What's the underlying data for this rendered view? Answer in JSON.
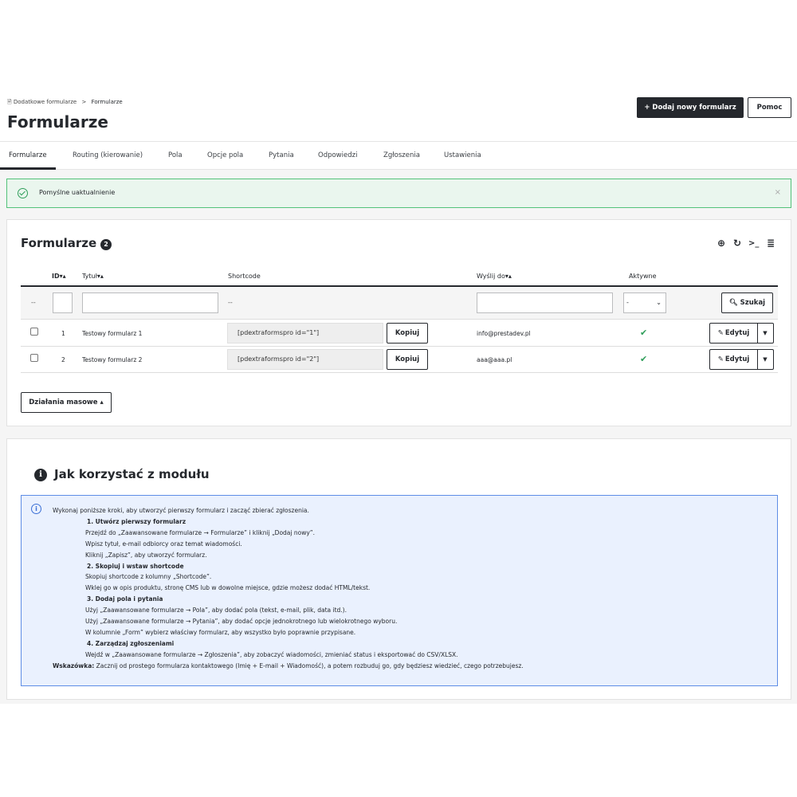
{
  "breadcrumb": {
    "parent": "Dodatkowe formularze",
    "separator": ">",
    "current": "Formularze"
  },
  "page_title": "Formularze",
  "toolbar": {
    "add_label": "+ Dodaj nowy formularz",
    "help_label": "Pomoc"
  },
  "tabs": [
    {
      "label": "Formularze",
      "active": true
    },
    {
      "label": "Routing (kierowanie)"
    },
    {
      "label": "Pola"
    },
    {
      "label": "Opcje pola"
    },
    {
      "label": "Pytania"
    },
    {
      "label": "Odpowiedzi"
    },
    {
      "label": "Zgłoszenia"
    },
    {
      "label": "Ustawienia"
    }
  ],
  "alert": {
    "message": "Pomyślne uaktualnienie",
    "close": "×"
  },
  "list": {
    "title": "Formularze",
    "count": "2",
    "columns": {
      "id": "ID",
      "title": "Tytuł",
      "shortcode": "Shortcode",
      "send_to": "Wyślij do",
      "active": "Aktywne",
      "sort": "▾▴"
    },
    "filters": {
      "dash": "--",
      "shortcode_dash": "--",
      "select_value": "-",
      "search_label": "Szukaj"
    },
    "rows": [
      {
        "id": "1",
        "title": "Testowy formularz 1",
        "shortcode": "[pdextraformspro id=\"1\"]",
        "copy": "Kopiuj",
        "send_to": "info@prestadev.pl",
        "edit": "Edytuj"
      },
      {
        "id": "2",
        "title": "Testowy formularz 2",
        "shortcode": "[pdextraformspro id=\"2\"]",
        "copy": "Kopiuj",
        "send_to": "aaa@aaa.pl",
        "edit": "Edytuj"
      }
    ],
    "bulk_label": "Działania masowe ▴"
  },
  "help": {
    "title": "Jak korzystać z modułu",
    "intro": "Wykonaj poniższe kroki, aby utworzyć pierwszy formularz i zacząć zbierać zgłoszenia.",
    "steps": [
      {
        "title": "1. Utwórz pierwszy formularz",
        "lines": [
          "Przejdź do „Zaawansowane formularze → Formularze” i kliknij „Dodaj nowy”.",
          "Wpisz tytuł, e-mail odbiorcy oraz temat wiadomości.",
          "Kliknij „Zapisz”, aby utworzyć formularz."
        ]
      },
      {
        "title": "2. Skopiuj i wstaw shortcode",
        "lines": [
          "Skopiuj shortcode z kolumny „Shortcode”.",
          "Wklej go w opis produktu, stronę CMS lub w dowolne miejsce, gdzie możesz dodać HTML/tekst."
        ]
      },
      {
        "title": "3. Dodaj pola i pytania",
        "lines": [
          "Użyj „Zaawansowane formularze → Pola”, aby dodać pola (tekst, e-mail, plik, data itd.).",
          "Użyj „Zaawansowane formularze → Pytania”, aby dodać opcje jednokrotnego lub wielokrotnego wyboru.",
          "W kolumnie „Form” wybierz właściwy formularz, aby wszystko było poprawnie przypisane."
        ]
      },
      {
        "title": "4. Zarządzaj zgłoszeniami",
        "lines": [
          "Wejdź w „Zaawansowane formularze → Zgłoszenia”, aby zobaczyć wiadomości, zmieniać status i eksportować do CSV/XLSX."
        ]
      }
    ],
    "tip_label": "Wskazówka:",
    "tip_text": "Zacznij od prostego formularza kontaktowego (Imię + E-mail + Wiadomość), a potem rozbuduj go, gdy będziesz wiedzieć, czego potrzebujesz."
  },
  "colors": {
    "dark": "#25282d",
    "success": "#2f9e5a",
    "info": "#3b6fd6"
  },
  "icons": [
    "file-icon",
    "plus-icon",
    "check-circle-icon",
    "close-icon",
    "add-circle-icon",
    "refresh-icon",
    "terminal-icon",
    "database-icon",
    "search-icon",
    "pencil-icon",
    "caret-down-icon",
    "check-icon",
    "info-icon"
  ]
}
